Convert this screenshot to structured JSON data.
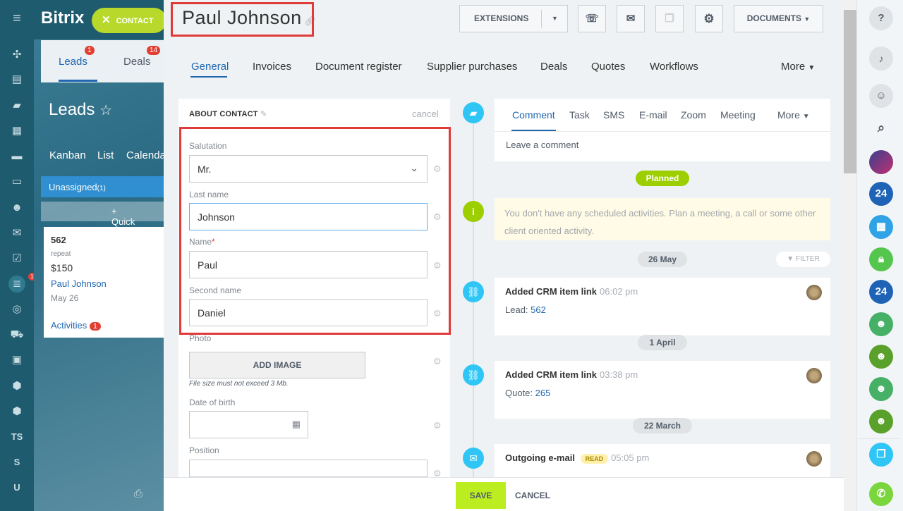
{
  "rail": {
    "badge": "15",
    "labels": [
      "TS",
      "S",
      "U"
    ]
  },
  "background": {
    "app_name": "Bitrix",
    "contact_button": "CONTACT",
    "tabs": [
      {
        "label": "Leads",
        "badge": "1"
      },
      {
        "label": "Deals",
        "badge": "14"
      }
    ],
    "title": "Leads",
    "views": [
      "Kanban",
      "List",
      "Calenda"
    ],
    "column": {
      "name": "Unassigned",
      "count": "(1)"
    },
    "quick_lead": "+ Quick Lea",
    "card": {
      "id": "562",
      "tag": "repeat",
      "amount": "$150",
      "name": "Paul Johnson",
      "date": "May 26",
      "activities": "Activities",
      "activities_count": "1"
    }
  },
  "header": {
    "title": "Paul Johnson",
    "extensions": "EXTENSIONS",
    "documents": "DOCUMENTS"
  },
  "tabs": [
    "General",
    "Invoices",
    "Document register",
    "Supplier purchases",
    "Deals",
    "Quotes",
    "Workflows"
  ],
  "tabs_more": "More",
  "form": {
    "title": "ABOUT CONTACT",
    "cancel": "cancel",
    "salutation_label": "Salutation",
    "salutation_value": "Mr.",
    "last_name_label": "Last name",
    "last_name_value": "Johnson",
    "name_label": "Name",
    "name_required": "*",
    "name_value": "Paul",
    "second_name_label": "Second name",
    "second_name_value": "Daniel",
    "photo_label": "Photo",
    "add_image": "ADD IMAGE",
    "file_note": "File size must not exceed 3 Mb.",
    "dob_label": "Date of birth",
    "position_label": "Position"
  },
  "timeline": {
    "composer_tabs": [
      "Comment",
      "Task",
      "SMS",
      "E-mail",
      "Zoom",
      "Meeting"
    ],
    "composer_more": "More",
    "comment_placeholder": "Leave a comment",
    "planned": "Planned",
    "info_text": "You don't have any scheduled activities. Plan a meeting, a call or some other client oriented activity.",
    "filter": "FILTER",
    "dates": [
      "26 May",
      "1 April",
      "22 March"
    ],
    "events": [
      {
        "title": "Added CRM item link",
        "time": "06:02 pm",
        "sub_label": "Lead:",
        "sub_link": "562"
      },
      {
        "title": "Added CRM item link",
        "time": "03:38 pm",
        "sub_label": "Quote:",
        "sub_link": "265"
      },
      {
        "title": "Outgoing e-mail",
        "badge": "READ",
        "time": "05:05 pm"
      }
    ]
  },
  "footer": {
    "save": "SAVE",
    "cancel": "CANCEL"
  },
  "right_rail": {
    "labels": [
      "24",
      "24"
    ]
  },
  "colors": {
    "accent": "#2067b0",
    "save": "#bbed21",
    "highlight": "#e03a3a",
    "rail": "#1f5b6e",
    "planned": "#9dcf00"
  }
}
